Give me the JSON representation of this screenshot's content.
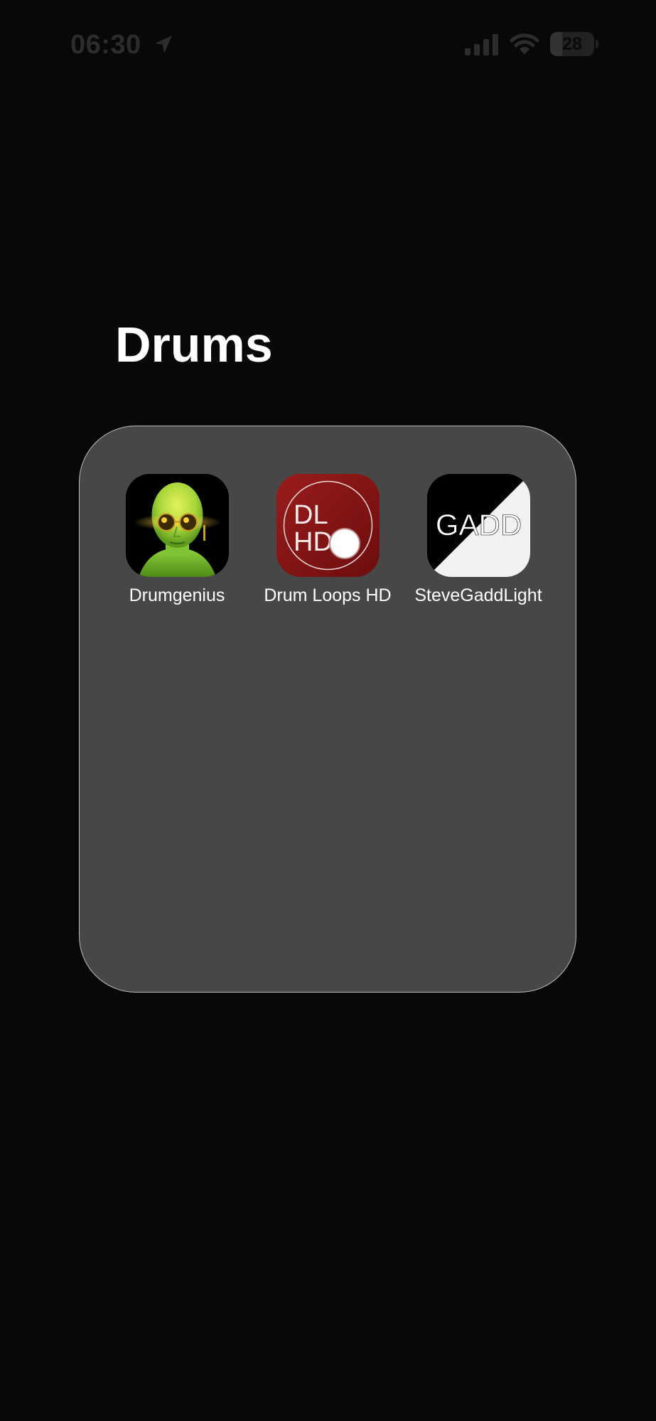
{
  "status_bar": {
    "time": "06:30",
    "battery_level": "28",
    "battery_fraction": 0.28,
    "icons": [
      "location-arrow-icon",
      "cellular-signal-icon",
      "wifi-icon",
      "battery-icon"
    ]
  },
  "folder": {
    "title": "Drums",
    "apps": [
      {
        "label": "Drumgenius",
        "icon": "drumgenius-app-icon"
      },
      {
        "label": "Drum Loops HD",
        "icon": "drum-loops-hd-app-icon",
        "icon_text": [
          "DL",
          "HD"
        ]
      },
      {
        "label": "SteveGaddLight",
        "icon": "stevegaddlight-app-icon",
        "icon_text": "GADD"
      }
    ]
  },
  "colors": {
    "background": "#080808",
    "folder_panel": "#474747",
    "folder_border": "#bdbdbd",
    "dlhd_red": "#8e1616",
    "drumgenius_green": "#8fd43a"
  }
}
